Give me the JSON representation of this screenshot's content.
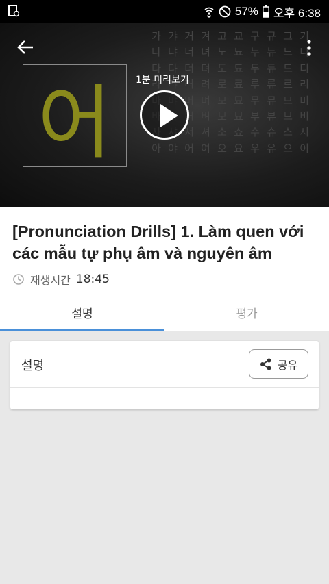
{
  "status_bar": {
    "battery": "57%",
    "time": "오후 6:38"
  },
  "video": {
    "big_character": "어",
    "preview_label": "1분 미리보기",
    "grid_rows": [
      [
        "가",
        "갸",
        "거",
        "겨",
        "고",
        "교",
        "구",
        "규",
        "그",
        "기"
      ],
      [
        "나",
        "냐",
        "너",
        "녀",
        "노",
        "뇨",
        "누",
        "뉴",
        "느",
        "니"
      ],
      [
        "다",
        "댜",
        "더",
        "뎌",
        "도",
        "됴",
        "두",
        "듀",
        "드",
        "디"
      ],
      [
        "라",
        "랴",
        "러",
        "려",
        "로",
        "료",
        "루",
        "류",
        "르",
        "리"
      ],
      [
        "마",
        "먀",
        "머",
        "며",
        "모",
        "묘",
        "무",
        "뮤",
        "므",
        "미"
      ],
      [
        "바",
        "뱌",
        "버",
        "벼",
        "보",
        "뵤",
        "부",
        "뷰",
        "브",
        "비"
      ],
      [
        "사",
        "샤",
        "서",
        "셔",
        "소",
        "쇼",
        "수",
        "슈",
        "스",
        "시"
      ],
      [
        "아",
        "야",
        "어",
        "여",
        "오",
        "요",
        "우",
        "유",
        "으",
        "이"
      ]
    ]
  },
  "lesson": {
    "title": "[Pronunciation Drills] 1. Làm quen với các mẫu tự phụ âm và nguyên âm",
    "duration_label": "재생시간",
    "duration_value": "18:45"
  },
  "tabs": [
    {
      "label": "설명",
      "active": true
    },
    {
      "label": "평가",
      "active": false
    }
  ],
  "card": {
    "title": "설명",
    "share_label": "공유"
  },
  "colors": {
    "accent": "#4a90d9",
    "character": "#8a8a1c"
  }
}
